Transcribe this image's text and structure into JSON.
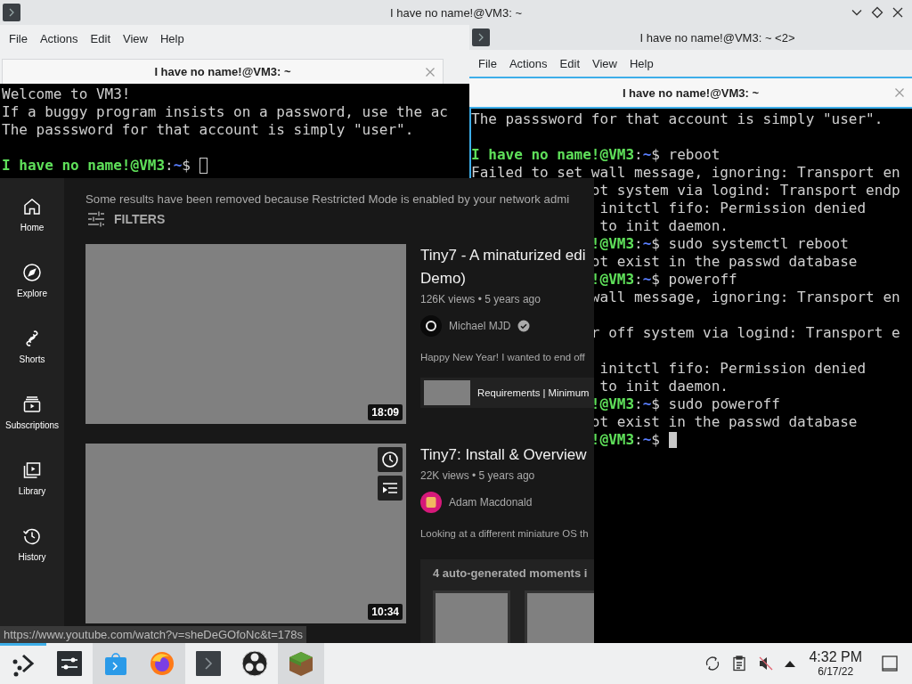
{
  "terminal_1": {
    "title": "I have no name!@VM3: ~",
    "menu": [
      "File",
      "Actions",
      "Edit",
      "View",
      "Help"
    ],
    "tab": "I have no name!@VM3: ~",
    "cursor_focused": false,
    "lines": [
      {
        "kind": "text",
        "text": "Welcome to VM3!"
      },
      {
        "kind": "text",
        "text": "If a buggy program insists on a password, use the ac"
      },
      {
        "kind": "text",
        "text": "The passsword for that account is simply \"user\"."
      },
      {
        "kind": "blank"
      },
      {
        "kind": "prompt",
        "user": "I have no name!@VM3",
        "colon": ":",
        "path": "~",
        "dollar": "$",
        "cursor": true
      }
    ]
  },
  "terminal_2": {
    "title": "I have no name!@VM3: ~ <2>",
    "menu": [
      "File",
      "Actions",
      "Edit",
      "View",
      "Help"
    ],
    "tab": "I have no name!@VM3: ~",
    "cursor_focused": true,
    "lines": [
      {
        "kind": "text",
        "text": "The passsword for that account is simply \"user\".",
        "cut": false
      },
      {
        "kind": "blank"
      },
      {
        "kind": "prompt",
        "user": "I have no name!@VM3",
        "colon": ":",
        "path": "~",
        "dollar": "$",
        "command": "reboot",
        "cut": false
      },
      {
        "kind": "text",
        "text": "Failed to set wall message, ignoring: Transport en",
        "cut": false
      },
      {
        "kind": "text",
        "text": "ot system via logind: Transport endp",
        "cut": true
      },
      {
        "kind": "text",
        "text": " initctl fifo: Permission denied",
        "cut": true
      },
      {
        "kind": "text",
        "text": " to init daemon.",
        "cut": true
      },
      {
        "kind": "prompt",
        "user": "!@VM3",
        "colon": ":",
        "path": "~",
        "dollar": "$",
        "command": "sudo systemctl reboot",
        "cut": true
      },
      {
        "kind": "text",
        "text": "ot exist in the passwd database",
        "cut": true
      },
      {
        "kind": "prompt",
        "user": "!@VM3",
        "colon": ":",
        "path": "~",
        "dollar": "$",
        "command": "poweroff",
        "cut": true
      },
      {
        "kind": "text",
        "text": "wall message, ignoring: Transport en",
        "cut": true
      },
      {
        "kind": "blank"
      },
      {
        "kind": "text",
        "text": "r off system via logind: Transport e",
        "cut": true
      },
      {
        "kind": "blank"
      },
      {
        "kind": "text",
        "text": " initctl fifo: Permission denied",
        "cut": true
      },
      {
        "kind": "text",
        "text": " to init daemon.",
        "cut": true
      },
      {
        "kind": "prompt",
        "user": "!@VM3",
        "colon": ":",
        "path": "~",
        "dollar": "$",
        "command": "sudo poweroff",
        "cut": true
      },
      {
        "kind": "text",
        "text": "ot exist in the passwd database",
        "cut": true
      },
      {
        "kind": "prompt",
        "user": "!@VM3",
        "colon": ":",
        "path": "~",
        "dollar": "$",
        "cut": true,
        "cursor": true
      }
    ]
  },
  "browser": {
    "sidebar": [
      {
        "label": "Home"
      },
      {
        "label": "Explore"
      },
      {
        "label": "Shorts"
      },
      {
        "label": "Subscriptions"
      },
      {
        "label": "Library"
      },
      {
        "label": "History"
      }
    ],
    "notice": "Some results have been removed because Restricted Mode is enabled by your network admi",
    "filters": "FILTERS",
    "results": [
      {
        "duration": "18:09",
        "title_lines": [
          "Tiny7 - A minaturized edi",
          "Demo)"
        ],
        "meta": "126K views • 5 years ago",
        "channel": "Michael MJD",
        "verified": true,
        "description": "Happy New Year! I wanted to end off",
        "chapter": "Requirements | Minimum"
      },
      {
        "duration": "10:34",
        "hover_actions": true,
        "title_lines": [
          "Tiny7: Install & Overview"
        ],
        "meta": "22K views • 5 years ago",
        "channel": "Adam Macdonald",
        "description": "Looking at a different miniature OS th",
        "moments": "4 auto-generated moments i"
      }
    ],
    "status_url": "https://www.youtube.com/watch?v=sheDeGOfoNc&t=178s"
  },
  "taskbar": {
    "apps": [
      {
        "selected": true,
        "highlighted": false
      },
      {
        "selected": false,
        "highlighted": false
      },
      {
        "selected": false,
        "highlighted": true
      },
      {
        "selected": false,
        "highlighted": true
      },
      {
        "selected": false,
        "highlighted": false
      },
      {
        "selected": false,
        "highlighted": false
      },
      {
        "selected": false,
        "highlighted": true
      }
    ],
    "muted": true,
    "time": "4:32 PM",
    "date": "6/17/22"
  }
}
